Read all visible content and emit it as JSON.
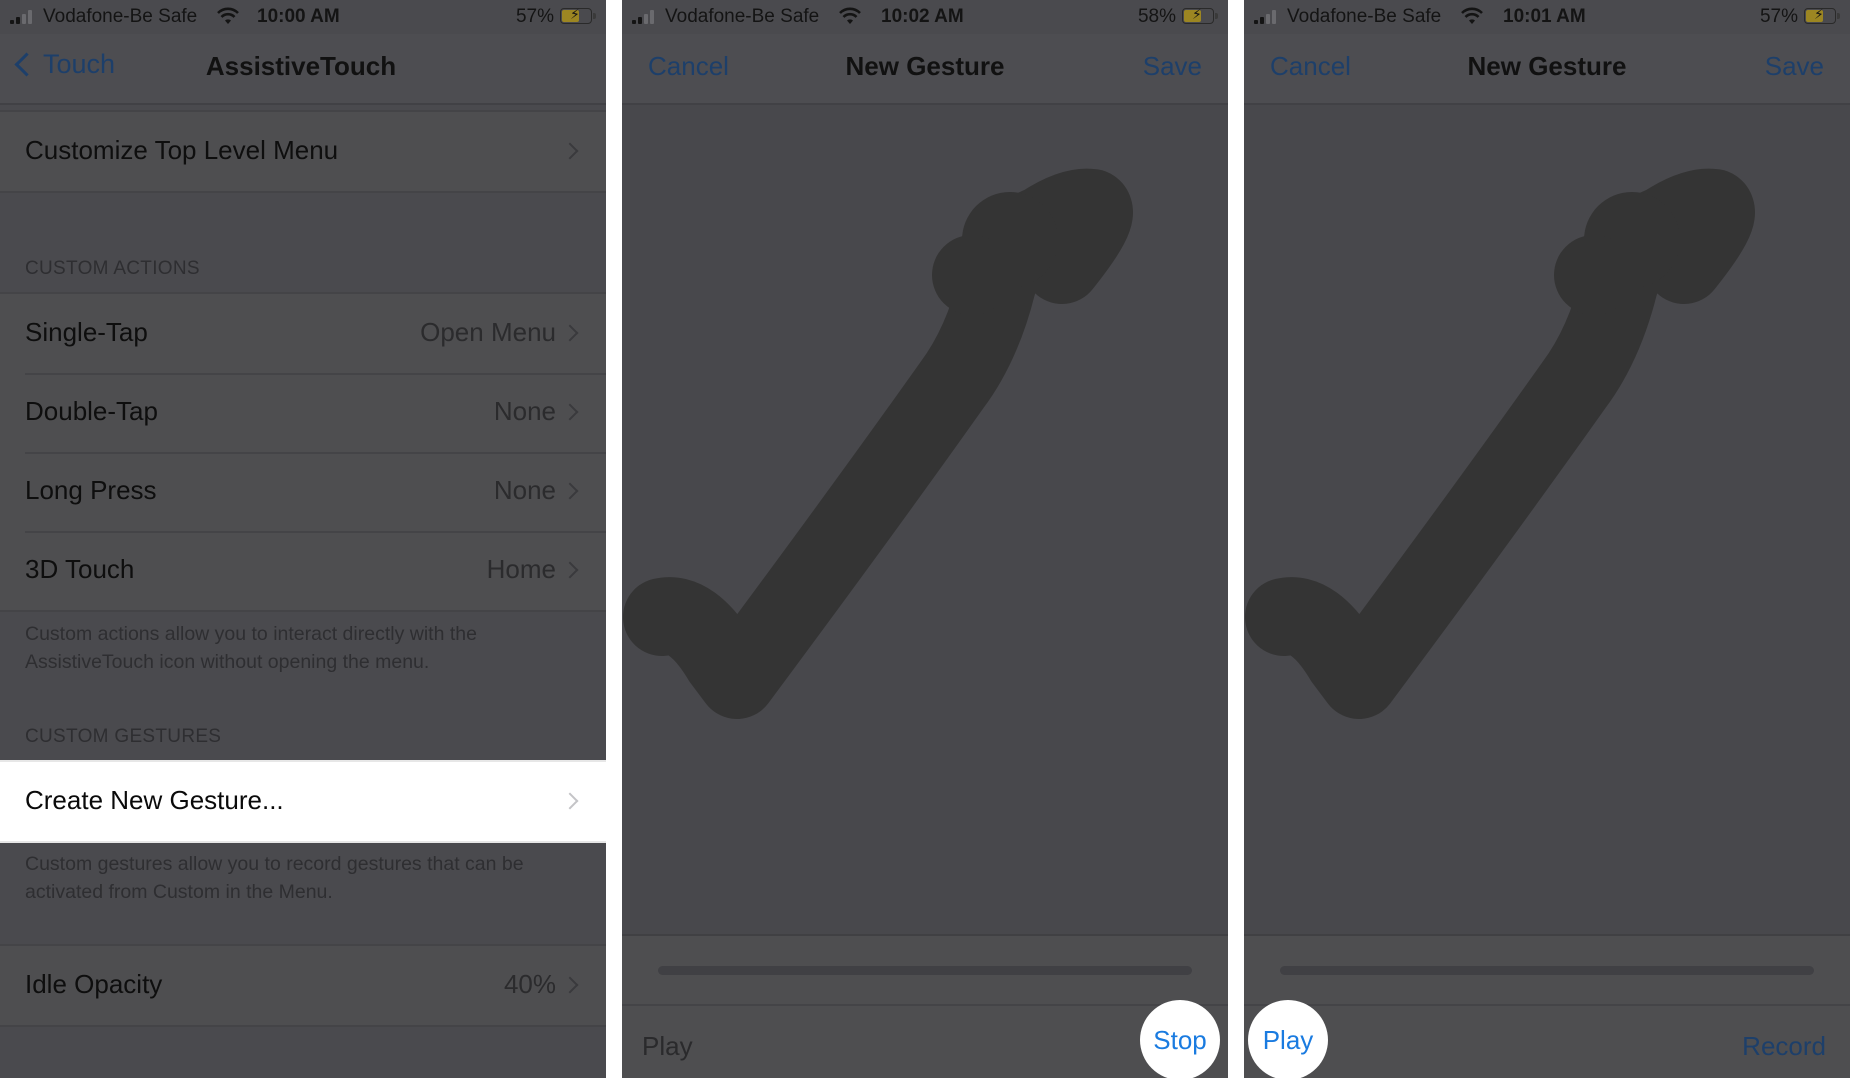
{
  "colors": {
    "ios_blue": "#1a7be0",
    "dimmed_blue": "#1d3f6a",
    "overlay_bg": "#4a4a4e",
    "gesture_stroke": "#343434",
    "highlight": "#ffffff",
    "battery_fill": "#9c8622"
  },
  "panels": [
    {
      "status": {
        "carrier": "Vodafone-Be Safe",
        "time": "10:00 AM",
        "battery": "57%",
        "signal_icon": "cellular-signal-icon",
        "wifi_icon": "wifi-icon",
        "battery_icon": "battery-charging-icon"
      },
      "nav": {
        "back_label": "Touch",
        "title": "AssistiveTouch"
      },
      "top_row": {
        "label": "Customize Top Level Menu"
      },
      "custom_actions": {
        "header": "CUSTOM ACTIONS",
        "rows": [
          {
            "label": "Single-Tap",
            "value": "Open Menu"
          },
          {
            "label": "Double-Tap",
            "value": "None"
          },
          {
            "label": "Long Press",
            "value": "None"
          },
          {
            "label": "3D Touch",
            "value": "Home"
          }
        ],
        "footer": "Custom actions allow you to interact directly with the AssistiveTouch icon without opening the menu."
      },
      "custom_gestures": {
        "header": "CUSTOM GESTURES",
        "rows": [
          {
            "label": "Create New Gesture..."
          }
        ],
        "footer": "Custom gestures allow you to record gestures that can be activated from Custom in the Menu."
      },
      "idle_opacity": {
        "label": "Idle Opacity",
        "value": "40%"
      }
    },
    {
      "status": {
        "carrier": "Vodafone-Be Safe",
        "time": "10:02 AM",
        "battery": "58%"
      },
      "nav": {
        "cancel_label": "Cancel",
        "title": "New Gesture",
        "save_label": "Save"
      },
      "toolbar": {
        "left_label": "Play",
        "right_label": "Stop",
        "highlighted": "Stop"
      }
    },
    {
      "status": {
        "carrier": "Vodafone-Be Safe",
        "time": "10:01 AM",
        "battery": "57%"
      },
      "nav": {
        "cancel_label": "Cancel",
        "title": "New Gesture",
        "save_label": "Save"
      },
      "toolbar": {
        "left_label": "Play",
        "right_label": "Record",
        "highlighted": "Play"
      }
    }
  ]
}
